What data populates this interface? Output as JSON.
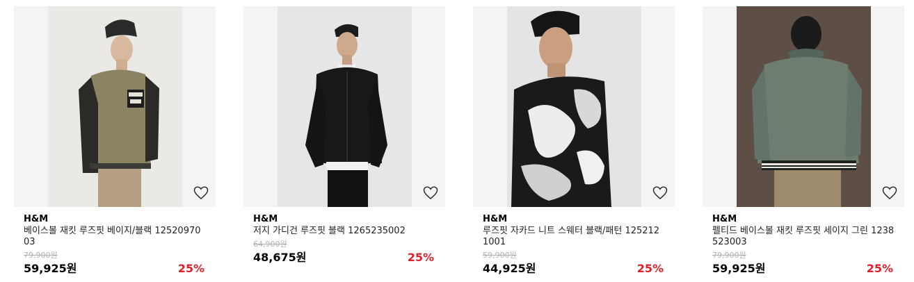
{
  "products": [
    {
      "brand": "H&M",
      "name": "베이스볼 재킷 루즈핏 베이지/블랙 1252097003",
      "original_price": "79,900원",
      "price": "59,925원",
      "discount": "25%",
      "icon": "heart-outline-icon"
    },
    {
      "brand": "H&M",
      "name": "저지 가디건 루즈핏 블랙 1265235002",
      "original_price": "64,900원",
      "price": "48,675원",
      "discount": "25%",
      "icon": "heart-outline-icon"
    },
    {
      "brand": "H&M",
      "name": "루즈핏 자카드 니트 스웨터 블랙/패턴 1252121001",
      "original_price": "59,900원",
      "price": "44,925원",
      "discount": "25%",
      "icon": "heart-outline-icon"
    },
    {
      "brand": "H&M",
      "name": "펠티드 베이스볼 재킷 루즈핏 세이지 그린 1238523003",
      "original_price": "79,900원",
      "price": "59,925원",
      "discount": "25%",
      "icon": "heart-outline-icon"
    }
  ],
  "colors": {
    "discount": "#e3202a",
    "card_background": "#f4f4f4",
    "strike_price": "#b0b0b0"
  }
}
